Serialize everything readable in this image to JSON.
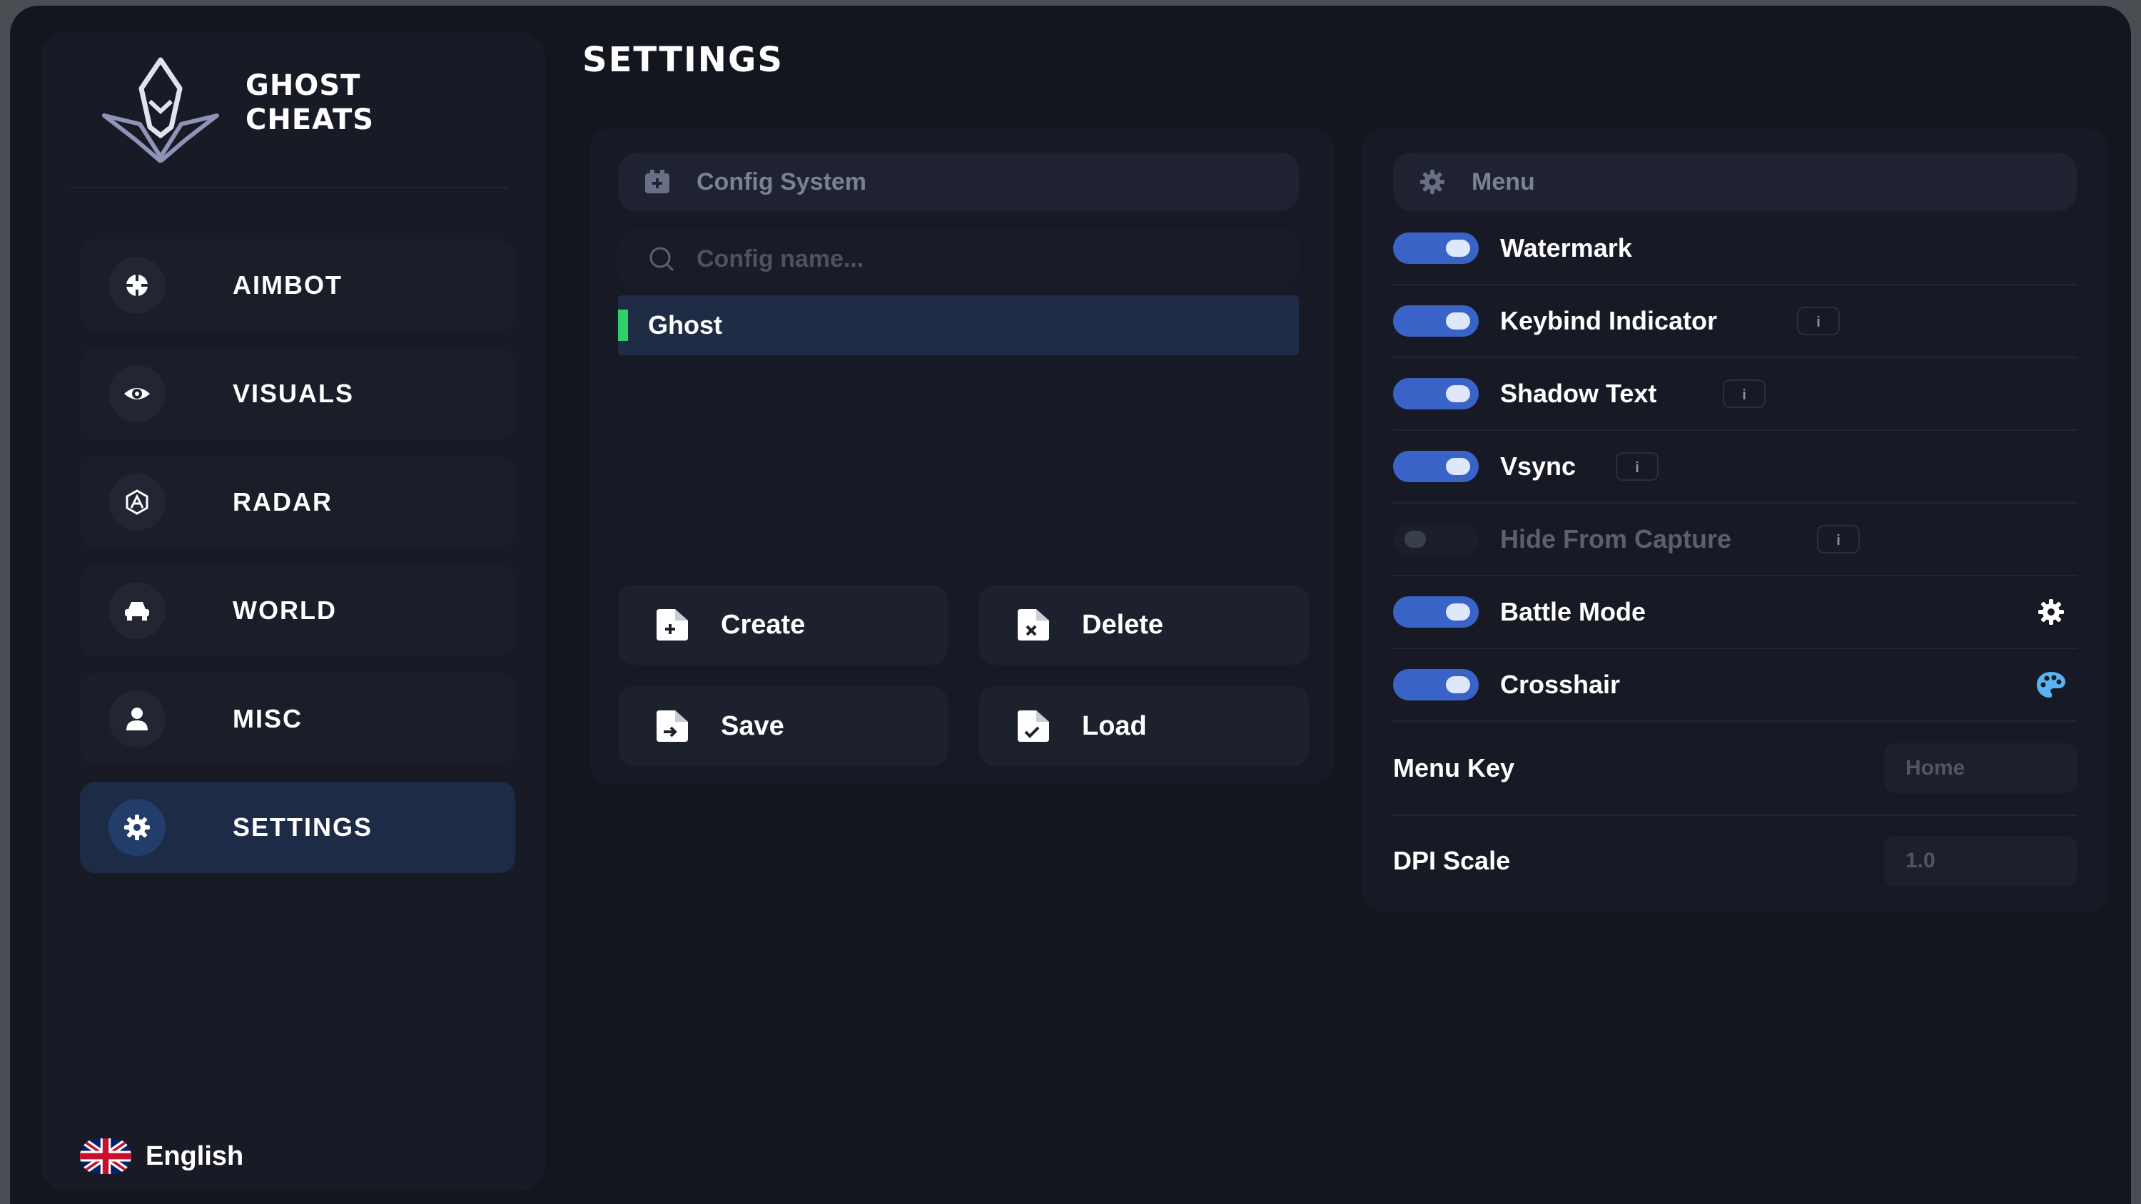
{
  "brand": {
    "name_line1": "GHOST",
    "name_line2": "CHEATS"
  },
  "sidebar": {
    "items": [
      {
        "label": "AIMBOT",
        "icon": "crosshair-icon",
        "active": false
      },
      {
        "label": "VISUALS",
        "icon": "eye-icon",
        "active": false
      },
      {
        "label": "RADAR",
        "icon": "radar-icon",
        "active": false
      },
      {
        "label": "WORLD",
        "icon": "car-icon",
        "active": false
      },
      {
        "label": "MISC",
        "icon": "user-icon",
        "active": false
      },
      {
        "label": "SETTINGS",
        "icon": "gear-icon",
        "active": true
      }
    ],
    "language": "English"
  },
  "page": {
    "title": "SETTINGS"
  },
  "config": {
    "header": "Config System",
    "search_placeholder": "Config name...",
    "items": [
      "Ghost"
    ],
    "buttons": {
      "create": "Create",
      "delete": "Delete",
      "save": "Save",
      "load": "Load"
    }
  },
  "menu": {
    "header": "Menu",
    "toggles": [
      {
        "label": "Watermark",
        "on": true
      },
      {
        "label": "Keybind Indicator",
        "on": true,
        "info": "i"
      },
      {
        "label": "Shadow Text",
        "on": true,
        "info": "i"
      },
      {
        "label": "Vsync",
        "on": true,
        "info": "i"
      },
      {
        "label": "Hide From Capture",
        "on": false,
        "info": "i"
      },
      {
        "label": "Battle Mode",
        "on": true,
        "extra_icon": "gear-icon"
      },
      {
        "label": "Crosshair",
        "on": true,
        "extra_icon": "palette-icon"
      }
    ],
    "menu_key": {
      "label": "Menu Key",
      "value": "Home"
    },
    "dpi_scale": {
      "label": "DPI Scale",
      "value": "1.0"
    }
  },
  "colors": {
    "accent": "#3a63c8",
    "active_nav": "#1d2b47",
    "selected_marker": "#2fd06a",
    "palette_icon": "#5ab4f2"
  }
}
